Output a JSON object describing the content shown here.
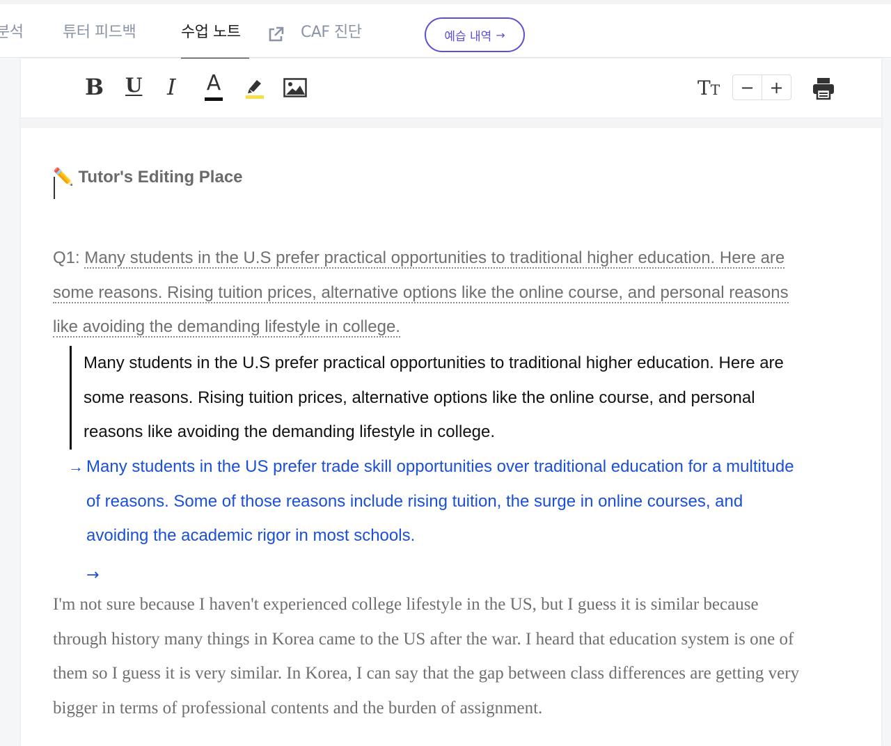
{
  "tabs": [
    {
      "label": "분석"
    },
    {
      "label": "튜터 피드백"
    },
    {
      "label": "수업 노트",
      "active": true
    },
    {
      "label": "CAF 진단"
    }
  ],
  "preview_button": {
    "label": "예습 내역",
    "icon": "arrow-right-icon"
  },
  "toolbar": {
    "bold": "B",
    "underline": "U",
    "italic": "I",
    "text_color": "A",
    "font_size": "TT",
    "decrease": "−",
    "increase": "+"
  },
  "editor": {
    "title": "✏️ Tutor's Editing Place",
    "q1_prefix": "Q1: ",
    "q1_text": "Many students in the U.S prefer practical opportunities to traditional higher education. Here are some reasons. Rising tuition prices, alternative options like the online course, and personal reasons like avoiding the demanding lifestyle in college.",
    "quote": "Many students in the U.S prefer practical opportunities to traditional higher education. Here are some reasons. Rising tuition prices, alternative options like the online course, and personal reasons like avoiding the demanding lifestyle in college.",
    "arrow": "→",
    "correction": "Many students in the US prefer trade skill opportunities over traditional education for a multitude of reasons. Some of those reasons include rising tuition, the surge in online courses, and avoiding the academic rigor in most schools.",
    "comment": "I'm not sure because I haven't experienced college lifestyle in the US, but I guess it is similar because through history many things in Korea came to the US after the war. I heard that education system is one of them so I guess it is very similar. In Korea, I can say that the gap between class differences are getting very bigger in terms of professional contents and the burden of assignment."
  },
  "colors": {
    "accent": "#5b4fd6",
    "correction": "#1a4fd8",
    "muted": "#6f6f6f"
  }
}
